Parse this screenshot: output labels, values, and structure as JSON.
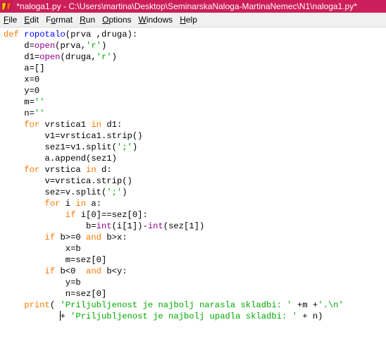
{
  "window": {
    "title": "*naloga1.py - C:\\Users\\martina\\Desktop\\SeminarskaNaloga-MartinaNemec\\N1\\naloga1.py*",
    "icon": "idle-icon"
  },
  "menu": {
    "items": [
      {
        "label": "File",
        "accel": "F"
      },
      {
        "label": "Edit",
        "accel": "E"
      },
      {
        "label": "Format",
        "accel": "o"
      },
      {
        "label": "Run",
        "accel": "R"
      },
      {
        "label": "Options",
        "accel": "O"
      },
      {
        "label": "Windows",
        "accel": "W"
      },
      {
        "label": "Help",
        "accel": "H"
      }
    ]
  },
  "colors": {
    "titlebar": "#cc1e5a",
    "keyword": "#ff7700",
    "string": "#00aa00",
    "builtin": "#900090",
    "defname": "#0000ff"
  },
  "code": {
    "lines": [
      [
        {
          "t": "def",
          "c": "kw"
        },
        {
          "t": " "
        },
        {
          "t": "ropotalo",
          "c": "df"
        },
        {
          "t": "(prva ,druga):"
        }
      ],
      [
        {
          "t": "    d="
        },
        {
          "t": "open",
          "c": "bi"
        },
        {
          "t": "(prva,"
        },
        {
          "t": "'r'",
          "c": "st"
        },
        {
          "t": ")"
        }
      ],
      [
        {
          "t": "    d1="
        },
        {
          "t": "open",
          "c": "bi"
        },
        {
          "t": "(druga,"
        },
        {
          "t": "'r'",
          "c": "st"
        },
        {
          "t": ")"
        }
      ],
      [
        {
          "t": "    a=[]"
        }
      ],
      [
        {
          "t": "    x=0"
        }
      ],
      [
        {
          "t": "    y=0"
        }
      ],
      [
        {
          "t": "    m="
        },
        {
          "t": "''",
          "c": "st"
        }
      ],
      [
        {
          "t": "    n="
        },
        {
          "t": "''",
          "c": "st"
        }
      ],
      [
        {
          "t": "    "
        },
        {
          "t": "for",
          "c": "kw"
        },
        {
          "t": " vrstica1 "
        },
        {
          "t": "in",
          "c": "kw"
        },
        {
          "t": " d1:"
        }
      ],
      [
        {
          "t": "        v1=vrstica1.strip()"
        }
      ],
      [
        {
          "t": "        sez1=v1.split("
        },
        {
          "t": "';'",
          "c": "st"
        },
        {
          "t": ")"
        }
      ],
      [
        {
          "t": "        a.append(sez1)"
        }
      ],
      [
        {
          "t": "    "
        },
        {
          "t": "for",
          "c": "kw"
        },
        {
          "t": " vrstica "
        },
        {
          "t": "in",
          "c": "kw"
        },
        {
          "t": " d:"
        }
      ],
      [
        {
          "t": "        v=vrstica.strip()"
        }
      ],
      [
        {
          "t": "        sez=v.split("
        },
        {
          "t": "';'",
          "c": "st"
        },
        {
          "t": ")"
        }
      ],
      [
        {
          "t": "        "
        },
        {
          "t": "for",
          "c": "kw"
        },
        {
          "t": " i "
        },
        {
          "t": "in",
          "c": "kw"
        },
        {
          "t": " a:"
        }
      ],
      [
        {
          "t": "            "
        },
        {
          "t": "if",
          "c": "kw"
        },
        {
          "t": " i[0]==sez[0]:"
        }
      ],
      [
        {
          "t": "                b="
        },
        {
          "t": "int",
          "c": "bi"
        },
        {
          "t": "(i[1])-"
        },
        {
          "t": "int",
          "c": "bi"
        },
        {
          "t": "(sez[1])"
        }
      ],
      [
        {
          "t": "        "
        },
        {
          "t": "if",
          "c": "kw"
        },
        {
          "t": " b>=0 "
        },
        {
          "t": "and",
          "c": "kw"
        },
        {
          "t": " b>x:"
        }
      ],
      [
        {
          "t": "            x=b"
        }
      ],
      [
        {
          "t": "            m=sez[0]"
        }
      ],
      [
        {
          "t": "        "
        },
        {
          "t": "if",
          "c": "kw"
        },
        {
          "t": " b<0  "
        },
        {
          "t": "and",
          "c": "kw"
        },
        {
          "t": " b<y:"
        }
      ],
      [
        {
          "t": "            y=b"
        }
      ],
      [
        {
          "t": "            n=sez[0]"
        }
      ],
      [
        {
          "t": "    "
        },
        {
          "t": "print",
          "c": "kw"
        },
        {
          "t": "( "
        },
        {
          "t": "'Priljubljenost je najbolj narasla skladbi: '",
          "c": "st"
        },
        {
          "t": " +m +"
        },
        {
          "t": "'.\\n'",
          "c": "st"
        }
      ],
      [
        {
          "t": "           "
        },
        {
          "t": "|",
          "c": "caret"
        },
        {
          "t": "+ "
        },
        {
          "t": "'Priljubljenost je najbolj upadla skladbi: '",
          "c": "st"
        },
        {
          "t": " + n)"
        }
      ]
    ]
  }
}
